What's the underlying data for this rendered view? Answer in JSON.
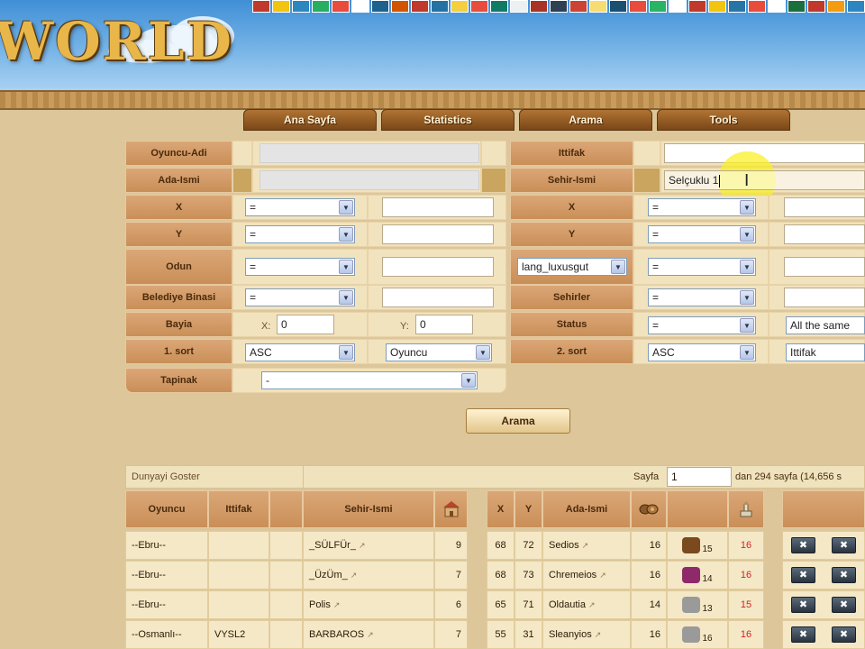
{
  "header": {
    "logo_text": "WORLD",
    "flags": [
      "#c0392b",
      "#f1c40f",
      "#2e86c1",
      "#27ae60",
      "#e74c3c",
      "#ffffff",
      "#1f618d",
      "#d35400",
      "#c0392b",
      "#2471a3",
      "#f4d03f",
      "#e74c3c",
      "#117a65",
      "#ecf0f1",
      "#a93226",
      "#2e4053",
      "#cb4335",
      "#f7dc6f",
      "#1b4f72",
      "#e74c3c",
      "#28b463",
      "#ffffff",
      "#c0392b",
      "#f1c40f",
      "#2874a6",
      "#e74c3c",
      "#ffffff",
      "#196f3d",
      "#c0392b",
      "#f39c12",
      "#2e86c1"
    ]
  },
  "nav": {
    "tabs": [
      "Ana Sayfa",
      "Statistics",
      "Arama",
      "Tools"
    ]
  },
  "form": {
    "left": {
      "player_name_label": "Oyuncu-Adi",
      "island_name_label": "Ada-Ismi",
      "x_label": "X",
      "y_label": "Y",
      "wood_label": "Odun",
      "townhall_label": "Belediye Binasi",
      "coords_label": "Bayia",
      "sort1_label": "1. sort",
      "temple_label": "Tapinak",
      "x_op": "=",
      "y_op": "=",
      "wood_op": "=",
      "townhall_op": "=",
      "coord_x_label": "X:",
      "coord_x_value": "0",
      "coord_y_label": "Y:",
      "coord_y_value": "0",
      "sort1_dir": "ASC",
      "sort1_field": "Oyuncu",
      "temple_value": "-"
    },
    "right": {
      "alliance_label": "Ittifak",
      "city_name_label": "Sehir-Ismi",
      "city_name_value": "Selçuklu 1",
      "x_label": "X",
      "y_label": "Y",
      "luxury_select": "lang_luxusgut",
      "cities_label": "Sehirler",
      "status_label": "Status",
      "sort2_label": "2. sort",
      "x_op": "=",
      "y_op": "=",
      "luxury_op": "=",
      "cities_op": "=",
      "status_op": "=",
      "status_value": "All the same",
      "sort2_dir": "ASC",
      "sort2_field": "Ittifak"
    },
    "search_button": "Arama"
  },
  "results": {
    "show_world": "Dunyayi Goster",
    "page_label": "Sayfa",
    "page_value": "1",
    "page_total": "dan 294 sayfa (14,656 s",
    "columns": {
      "player": "Oyuncu",
      "alliance": "Ittifak",
      "city": "Sehir-Ismi",
      "x": "X",
      "y": "Y",
      "island": "Ada-Ismi"
    },
    "rows": [
      {
        "player": "--Ebru--",
        "alliance": "",
        "city": "_SÜLFÜr_",
        "size": "9",
        "x": "68",
        "y": "72",
        "island": "Sedios",
        "wood": "16",
        "res_level": "15",
        "res_color": "#7a4a1e",
        "wonder": "16"
      },
      {
        "player": "--Ebru--",
        "alliance": "",
        "city": "_ÜzÜm_",
        "size": "7",
        "x": "68",
        "y": "73",
        "island": "Chremeios",
        "wood": "16",
        "res_level": "14",
        "res_color": "#8e2a6a",
        "wonder": "16"
      },
      {
        "player": "--Ebru--",
        "alliance": "",
        "city": "Polis",
        "size": "6",
        "x": "65",
        "y": "71",
        "island": "Oldautia",
        "wood": "14",
        "res_level": "13",
        "res_color": "#9a9a9a",
        "wonder": "15"
      },
      {
        "player": "--Osmanlı--",
        "alliance": "VYSL2",
        "city": "BARBAROS",
        "size": "7",
        "x": "55",
        "y": "31",
        "island": "Sleanyios",
        "wood": "16",
        "res_level": "16",
        "res_color": "#9a9a9a",
        "wonder": "16"
      }
    ]
  }
}
